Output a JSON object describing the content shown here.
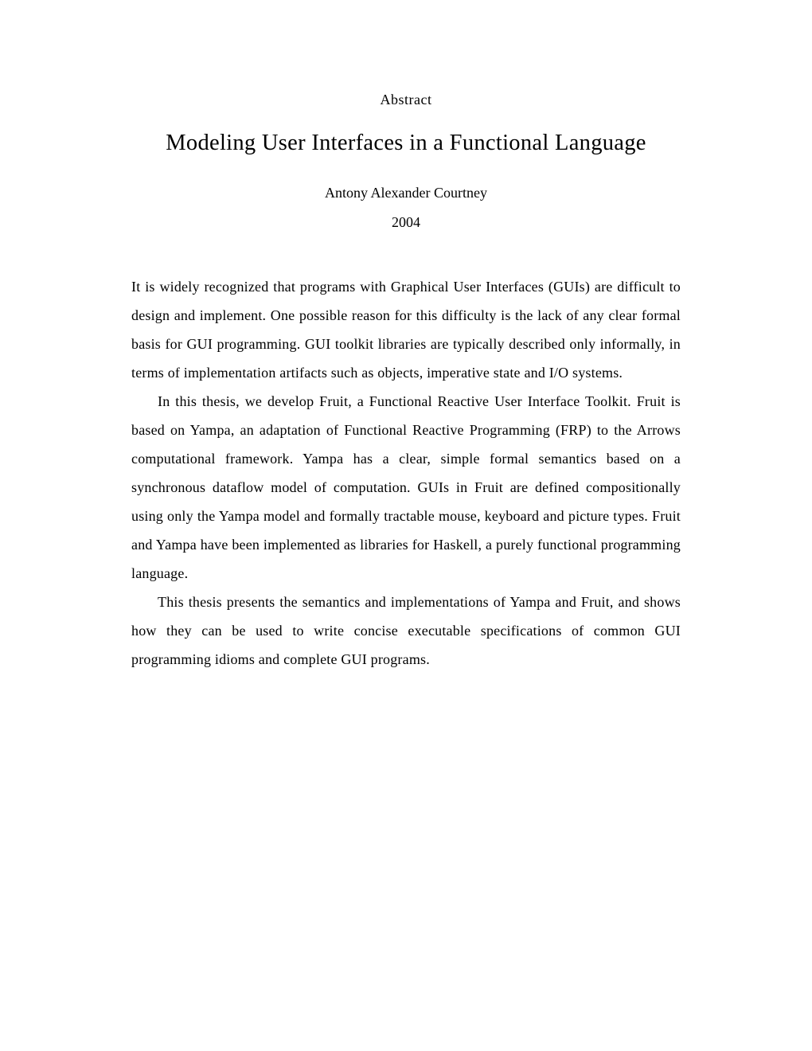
{
  "header": {
    "label": "Abstract",
    "title": "Modeling User Interfaces in a Functional Language",
    "author": "Antony Alexander Courtney",
    "year": "2004"
  },
  "paragraphs": {
    "p1": "It is widely recognized that programs with Graphical User Interfaces (GUIs) are difficult to design and implement. One possible reason for this difficulty is the lack of any clear formal basis for GUI programming. GUI toolkit libraries are typically described only informally, in terms of implementation artifacts such as objects, imperative state and I/O systems.",
    "p2": "In this thesis, we develop Fruit, a Functional Reactive User Interface Toolkit. Fruit is based on Yampa, an adaptation of Functional Reactive Programming (FRP) to the Arrows computational framework. Yampa has a clear, simple formal semantics based on a synchronous dataflow model of computation. GUIs in Fruit are defined compositionally using only the Yampa model and formally tractable mouse, keyboard and picture types. Fruit and Yampa have been implemented as libraries for Haskell, a purely functional programming language.",
    "p3": "This thesis presents the semantics and implementations of Yampa and Fruit, and shows how they can be used to write concise executable specifications of common GUI programming idioms and complete GUI programs."
  }
}
